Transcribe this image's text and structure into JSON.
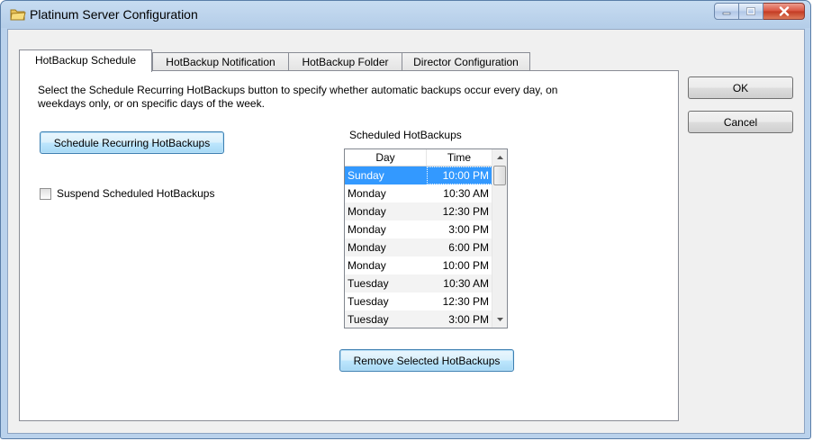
{
  "window": {
    "title": "Platinum Server Configuration",
    "icon": "folder-icon",
    "controls": [
      "minimize-icon",
      "maximize-icon",
      "close-icon"
    ]
  },
  "tabs": [
    {
      "label": "HotBackup Schedule",
      "active": true
    },
    {
      "label": "HotBackup Notification",
      "active": false
    },
    {
      "label": "HotBackup Folder",
      "active": false
    },
    {
      "label": "Director Configuration",
      "active": false
    }
  ],
  "panel": {
    "description": "Select the Schedule Recurring HotBackups button to specify whether automatic backups occur every day, on weekdays only, or on specific days of the week.",
    "schedule_button": "Schedule Recurring HotBackups",
    "suspend_checkbox": {
      "label": "Suspend Scheduled HotBackups",
      "checked": false
    },
    "scheduled_label": "Scheduled HotBackups",
    "list": {
      "columns": [
        "Day",
        "Time"
      ],
      "rows": [
        {
          "day": "Sunday",
          "time": "10:00 PM",
          "selected": true
        },
        {
          "day": "Monday",
          "time": "10:30 AM"
        },
        {
          "day": "Monday",
          "time": "12:30 PM"
        },
        {
          "day": "Monday",
          "time": "3:00 PM"
        },
        {
          "day": "Monday",
          "time": "6:00 PM"
        },
        {
          "day": "Monday",
          "time": "10:00 PM"
        },
        {
          "day": "Tuesday",
          "time": "10:30 AM"
        },
        {
          "day": "Tuesday",
          "time": "12:30 PM"
        },
        {
          "day": "Tuesday",
          "time": "3:00 PM"
        }
      ]
    },
    "remove_button": "Remove Selected HotBackups"
  },
  "dialog_buttons": {
    "ok": "OK",
    "cancel": "Cancel"
  },
  "colors": {
    "selection": "#3399ff",
    "title_bar": "#bad2ec",
    "close_button": "#c23a22"
  }
}
